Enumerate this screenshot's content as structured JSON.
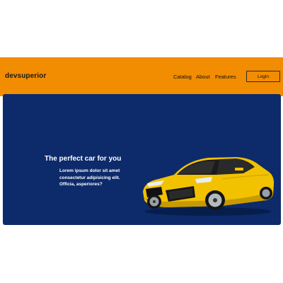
{
  "navbar": {
    "brand": "devsuperior",
    "links": [
      "Catalog",
      "About",
      "Features"
    ],
    "login_label": "Login",
    "color": "#F28C00"
  },
  "hero": {
    "title": "The perfect car for you",
    "text": "Lorem ipsum dolor sit amet consectetur adipisicing elit. Officia, asperiores?",
    "background": "#0D2A6B",
    "image": "yellow-sports-car"
  }
}
